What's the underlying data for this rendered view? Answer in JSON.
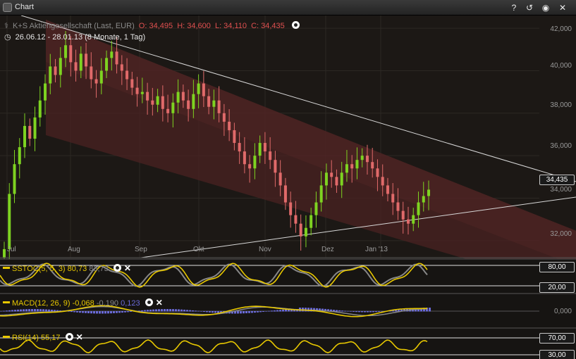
{
  "window": {
    "title": "Chart"
  },
  "toolbar": {
    "help": "?",
    "history": "↺",
    "settings": "◉",
    "close": "✕"
  },
  "header": {
    "instrument": "K+S Aktiengesellschaft (Last, EUR)",
    "open": "O: 34,495",
    "high": "H: 34,600",
    "low": "L: 34,110",
    "close": "C: 34,435",
    "range": "26.06.12 - 28.01.13 (8 Monate, 1 Tag)"
  },
  "price_axis": {
    "ticks": [
      "42,000",
      "40,000",
      "38,000",
      "36,000",
      "34,000",
      "32,000"
    ],
    "last": "34,435"
  },
  "months": [
    "Jul",
    "Aug",
    "Sep",
    "Okt",
    "Nov",
    "Dez",
    "Jan '13"
  ],
  "indicators": {
    "sstoc": {
      "label": "SSTOC(5, 5, 3)",
      "v1": "80,73",
      "v2": "83,73",
      "upper": "80,00",
      "lower": "20,00"
    },
    "macd": {
      "label": "MACD(12, 26, 9)",
      "v1": "-0,068",
      "v2": "-0,190",
      "v3": "0,123",
      "zero": "0,000"
    },
    "rsi": {
      "label": "RSI(14)",
      "v1": "55,17",
      "upper": "70,00",
      "lower": "30,00"
    }
  },
  "chart_data": {
    "type": "candlestick",
    "title": "K+S Aktiengesellschaft (Last, EUR)",
    "ylim": [
      31.2,
      42.6
    ],
    "close_series": [
      31.6,
      34.2,
      35.6,
      36.4,
      37.4,
      36.8,
      37.8,
      38.6,
      39.4,
      40.2,
      39.8,
      40.6,
      41.2,
      40.4,
      40.0,
      40.8,
      40.2,
      39.6,
      39.4,
      40.0,
      40.6,
      40.9,
      40.3,
      40.0,
      39.6,
      39.2,
      38.9,
      39.0,
      38.6,
      38.4,
      38.8,
      38.2,
      38.0,
      38.5,
      39.0,
      38.6,
      38.2,
      38.9,
      39.4,
      38.8,
      38.3,
      38.6,
      38.0,
      37.6,
      37.2,
      36.6,
      36.2,
      35.6,
      35.4,
      36.0,
      36.6,
      36.2,
      35.8,
      35.2,
      34.6,
      33.8,
      33.2,
      32.8,
      32.2,
      32.6,
      33.2,
      33.8,
      34.6,
      35.2,
      35.0,
      34.6,
      35.2,
      35.6,
      35.4,
      35.8,
      36.0,
      35.7,
      35.4,
      35.0,
      34.6,
      34.2,
      33.8,
      33.4,
      33.0,
      32.8,
      33.2,
      33.8,
      34.1,
      34.4
    ],
    "channel_upper_start": 42.4,
    "channel_upper_end": 34.0,
    "support_start": 31.8,
    "support_end": 33.6
  }
}
